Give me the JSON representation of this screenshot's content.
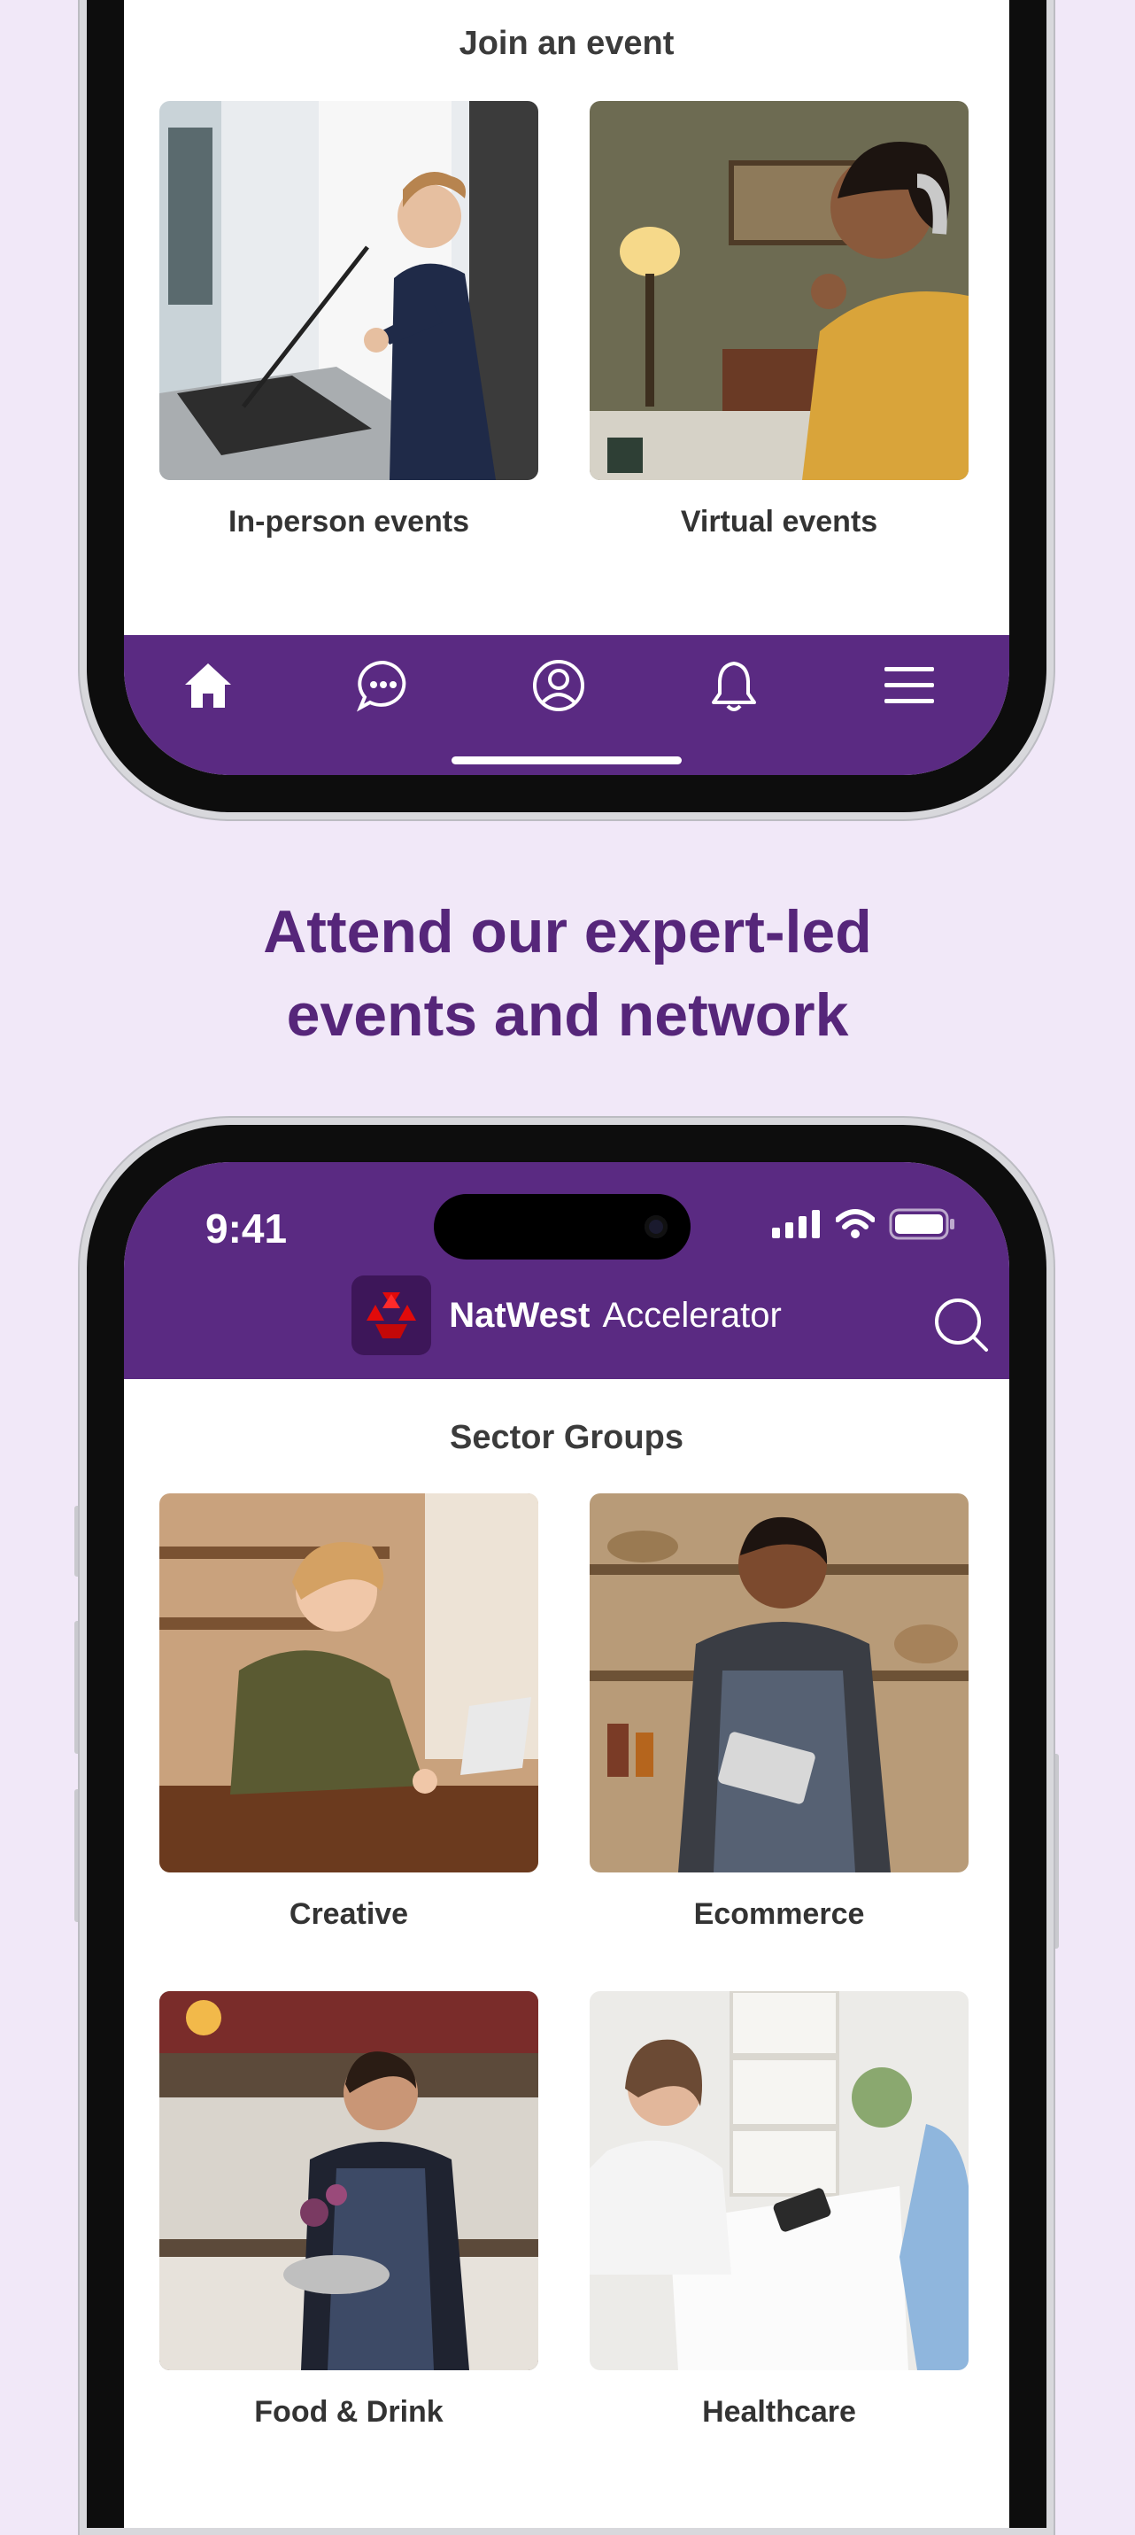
{
  "top_phone": {
    "section_title": "Join an event",
    "cards": [
      {
        "label": "In-person events"
      },
      {
        "label": "Virtual events"
      }
    ],
    "nav": [
      {
        "icon": "home-icon"
      },
      {
        "icon": "chat-icon"
      },
      {
        "icon": "profile-icon"
      },
      {
        "icon": "bell-icon"
      },
      {
        "icon": "menu-icon"
      }
    ]
  },
  "headline": {
    "line1": "Attend our expert-led",
    "line2": "events and network"
  },
  "bottom_phone": {
    "status": {
      "time": "9:41"
    },
    "header": {
      "brand_name": "NatWest",
      "brand_sub": "Accelerator"
    },
    "section_title": "Sector Groups",
    "cards": [
      {
        "label": "Creative"
      },
      {
        "label": "Ecommerce"
      },
      {
        "label": "Food & Drink"
      },
      {
        "label": "Healthcare"
      }
    ]
  },
  "colors": {
    "background": "#f1e8f8",
    "brand_purple": "#5a2a82",
    "headline_purple": "#56267a",
    "natwest_red": "#e10a0a"
  }
}
